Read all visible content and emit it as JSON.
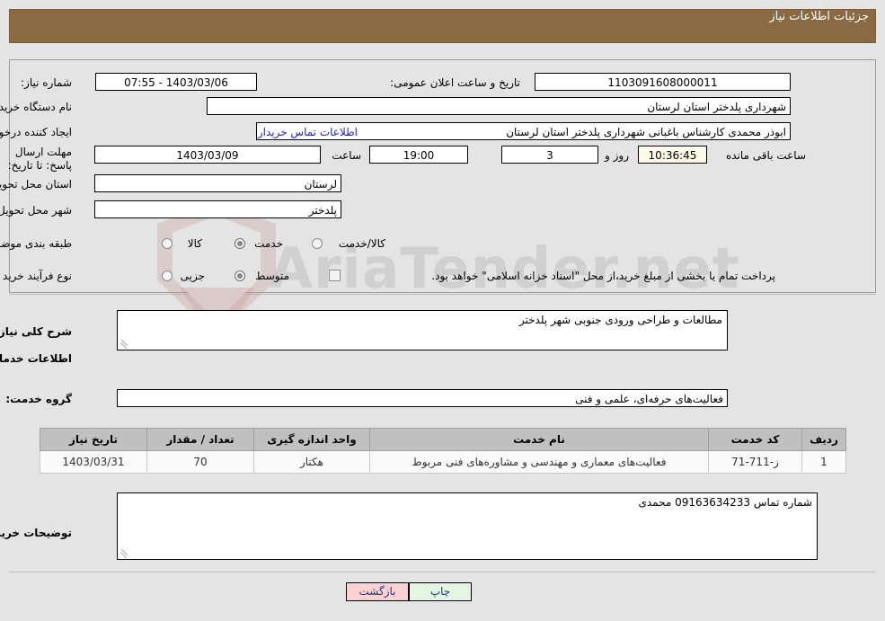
{
  "header": {
    "title": "جزئیات اطلاعات نیاز",
    "bar_color": "#8a6a42"
  },
  "watermark": {
    "text": "AriaTender.net"
  },
  "top_panel": {
    "need_number_label": "شماره نیاز:",
    "need_number_value": "1103091608000011",
    "announce_datetime_label": "تاریخ و ساعت اعلان عمومی:",
    "announce_datetime_value": "1403/03/06 - 07:55",
    "buyer_org_label": "نام دستگاه خریدار:",
    "buyer_org_value": "شهرداری پلدختر استان لرستان",
    "creator_label": "ایجاد کننده درخواست:",
    "creator_value": "ابوذر محمدی کارشناس باغبانی شهرداری پلدختر استان لرستان",
    "buyer_contact_link": "اطلاعات تماس خریدار",
    "deadline_label": "مهلت ارسال پاسخ: تا تاریخ:",
    "deadline_date_value": "1403/03/09",
    "deadline_hour_label": "ساعت",
    "deadline_hour_value": "19:00",
    "days_value": "3",
    "days_label": "روز و",
    "remaining_time_value": "10:36:45",
    "remaining_time_label": "ساعت باقی مانده",
    "delivery_province_label": "استان محل تحویل:",
    "delivery_province_value": "لرستان",
    "delivery_city_label": "شهر محل تحویل:",
    "delivery_city_value": "پلدختر",
    "category_label": "طبقه بندی موضوعی:",
    "category_options": [
      {
        "label": "کالا",
        "selected": false
      },
      {
        "label": "خدمت",
        "selected": true
      },
      {
        "label": "کالا/خدمت",
        "selected": false
      }
    ],
    "process_label": "نوع فرآیند خرید :",
    "process_options": [
      {
        "label": "جزیی",
        "selected": false
      },
      {
        "label": "متوسط",
        "selected": true
      }
    ],
    "treasury_checkbox_label": "پرداخت تمام یا بخشی از مبلغ خرید،از محل \"اسناد خزانه اسلامی\" خواهد بود.",
    "treasury_checkbox_checked": false
  },
  "middle": {
    "general_desc_label": "شرح کلی نیاز:",
    "general_desc_value": "مطالعات و طراحی ورودی جنوبی شهر پلدختر",
    "services_info_title": "اطلاعات خدمات مورد نیاز",
    "service_group_label": "گروه خدمت:",
    "service_group_value": "فعالیت‌های حرفه‌ای، علمی و فنی"
  },
  "table": {
    "columns": [
      "ردیف",
      "کد خدمت",
      "نام خدمت",
      "واحد اندازه گیری",
      "تعداد / مقدار",
      "تاریخ نیاز"
    ],
    "rows": [
      {
        "row": "1",
        "service_code": "ز-711-71",
        "service_name": "فعالیت‌های معماری و مهندسی و مشاوره‌های فنی مربوط",
        "unit": "هکتار",
        "quantity": "70",
        "need_date": "1403/03/31"
      }
    ]
  },
  "buyer_notes": {
    "label": "توضیحات خریدار:",
    "value": "شماره تماس 09163634233 محمدی"
  },
  "footer": {
    "print_label": "چاپ",
    "back_label": "بازگشت"
  }
}
